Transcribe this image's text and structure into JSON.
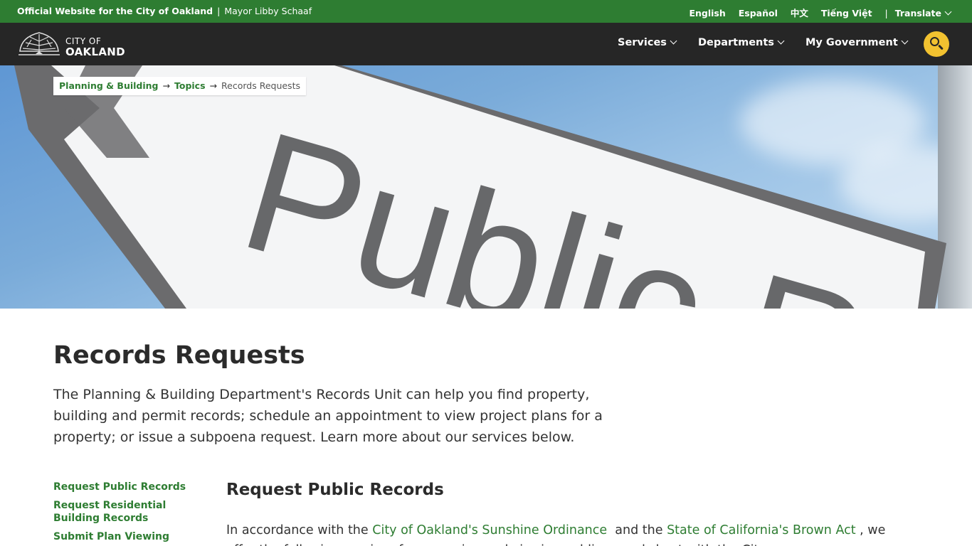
{
  "topbar": {
    "official": "Official Website for the City of Oakland",
    "separator": "|",
    "mayor": "Mayor Libby Schaaf",
    "languages": [
      "English",
      "Español",
      "中文",
      "Tiếng Việt"
    ],
    "pipe": "|",
    "translate": "Translate"
  },
  "logo": {
    "line1": "CITY OF",
    "line2": "OAKLAND"
  },
  "nav": {
    "items": [
      "Services",
      "Departments",
      "My Government"
    ]
  },
  "hero": {
    "sign_text": "Public Record"
  },
  "breadcrumb": {
    "items": [
      "Planning & Building",
      "Topics"
    ],
    "arrow": "→",
    "current": "Records Requests"
  },
  "page": {
    "title": "Records Requests",
    "intro": "The Planning & Building Department's Records Unit can help you find property, building and permit records; schedule an appointment to view project plans for a property; or issue a subpoena request. Learn more about our services below."
  },
  "sidenav": {
    "items": [
      "Request Public Records",
      "Request Residential Building Records",
      "Submit Plan Viewing"
    ]
  },
  "section": {
    "title": "Request Public Records",
    "text_before": "In accordance with the ",
    "link1": "City of Oakland's Sunshine Ordinance",
    "text_middle": "  and the ",
    "link2": "State of California's Brown Act",
    "text_after": " , we offer the following services for accessing and viewing public records kept with the City."
  },
  "colors": {
    "green": "#2e7d32",
    "nav_bg": "#262626",
    "search_yellow": "#f2c230"
  }
}
